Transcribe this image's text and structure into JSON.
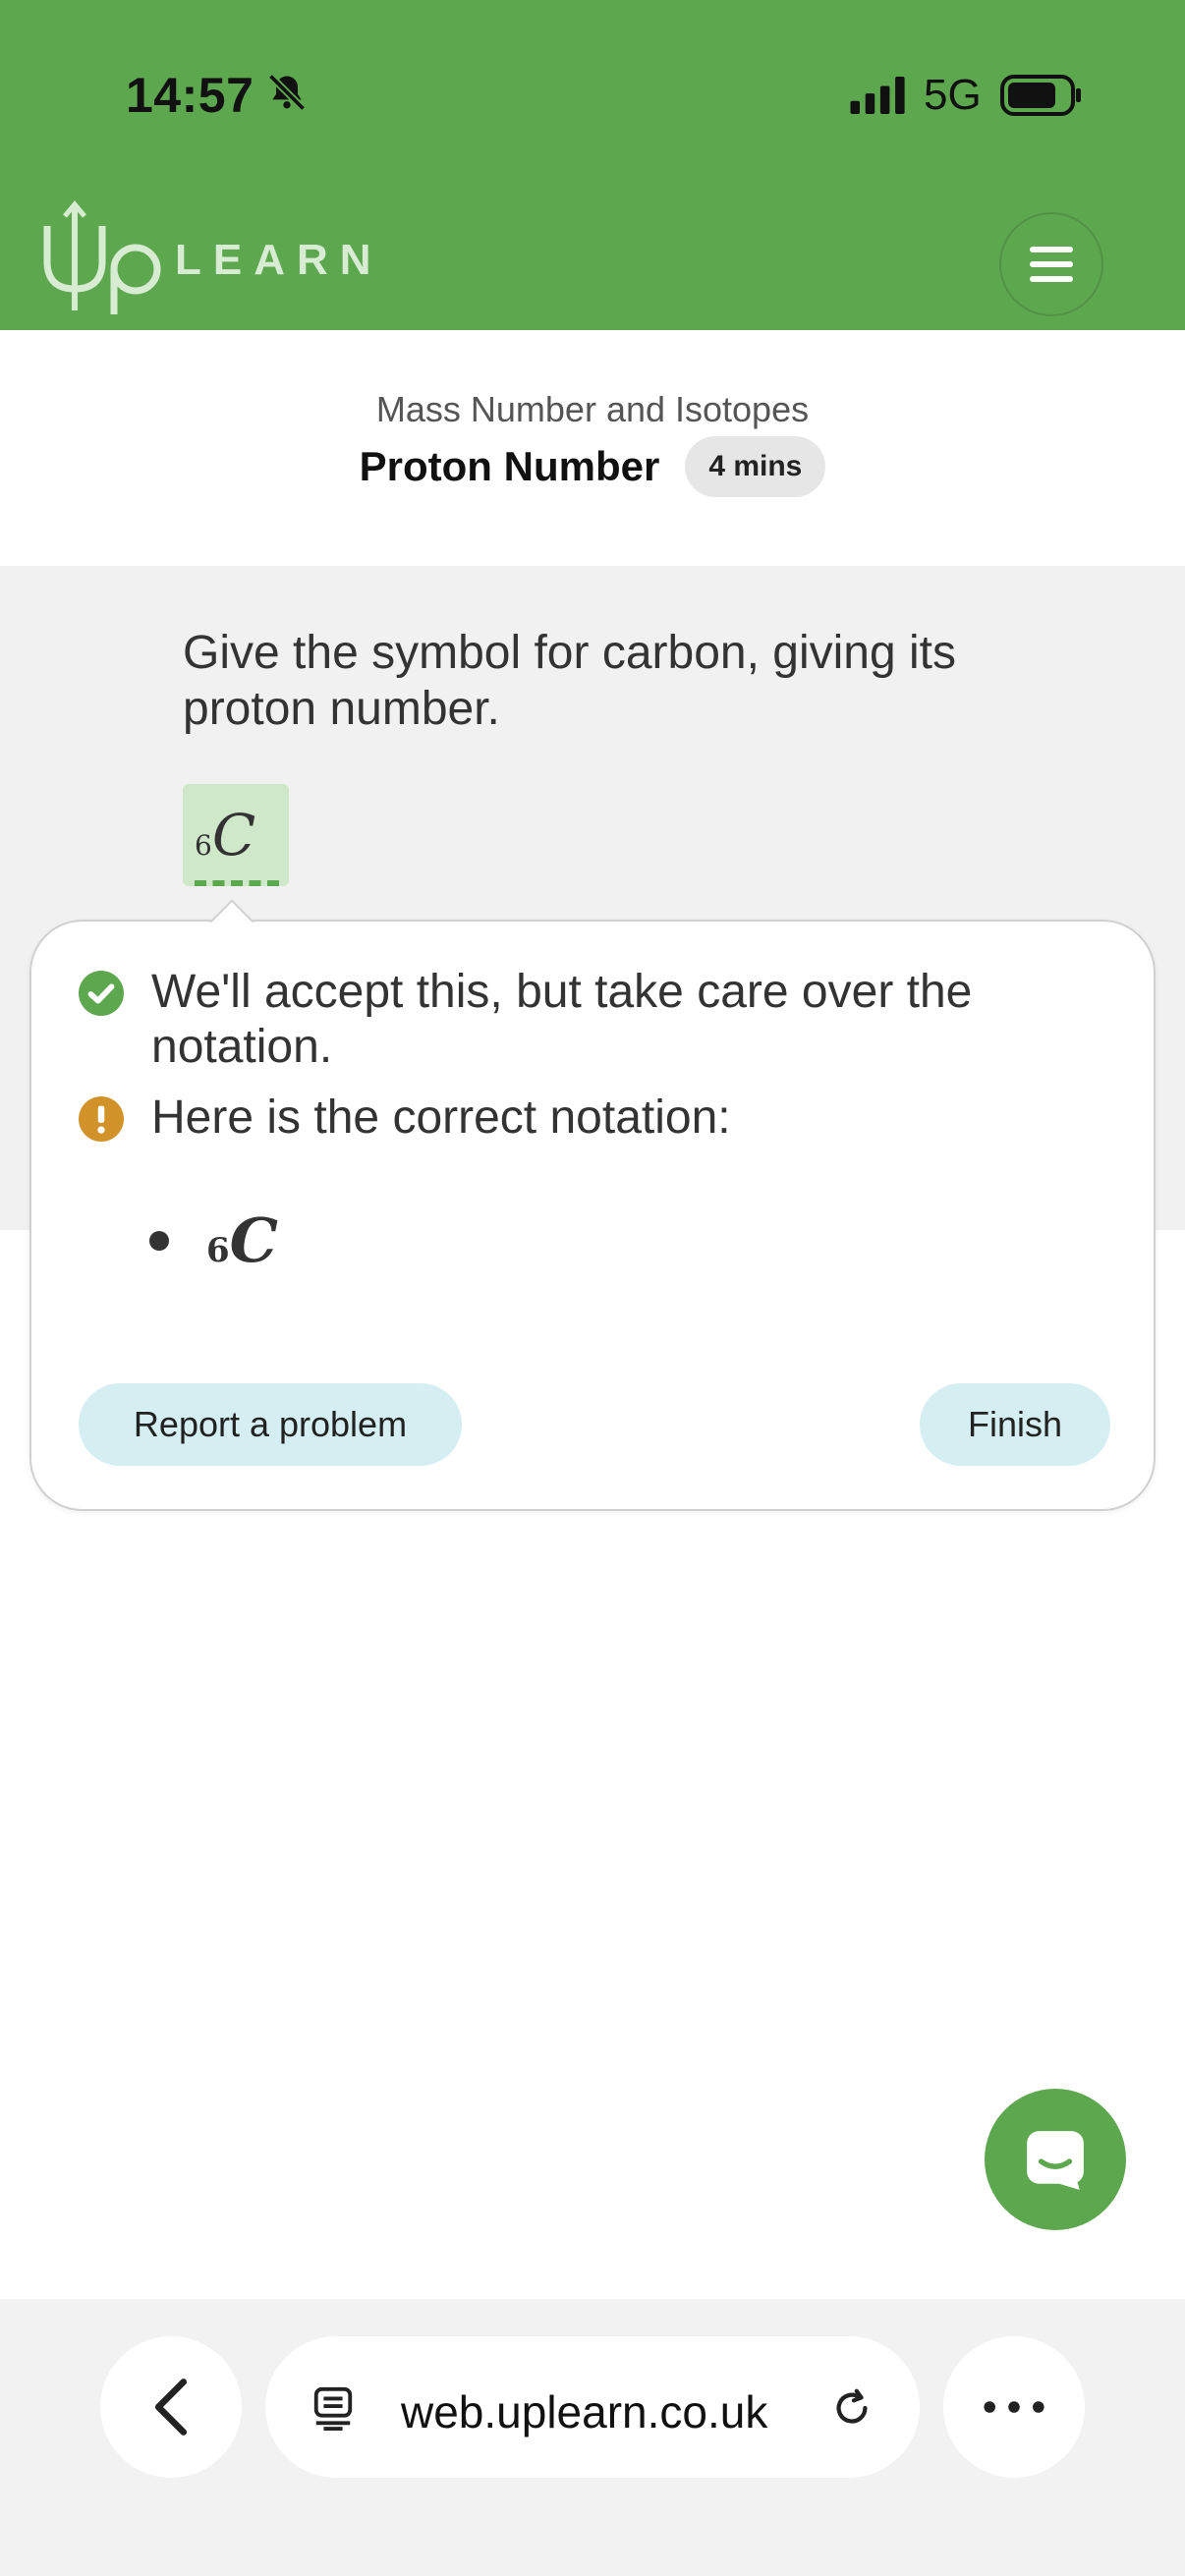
{
  "status_bar": {
    "time": "14:57",
    "network": "5G"
  },
  "header": {
    "logo_text": "LEARN"
  },
  "lesson": {
    "section": "Mass Number and Isotopes",
    "title": "Proton Number",
    "duration": "4 mins"
  },
  "question": {
    "text": "Give the symbol for carbon, giving its proton number.",
    "answer_subscript": "6",
    "answer_symbol": "C"
  },
  "feedback": {
    "accept_message": "We'll accept this, but take care over the notation.",
    "correction_message": "Here is the correct notation:",
    "correct_subscript": "6",
    "correct_symbol": "C",
    "report_label": "Report a problem",
    "finish_label": "Finish"
  },
  "browser": {
    "url": "web.uplearn.co.uk"
  },
  "colors": {
    "brand_green": "#5da74e",
    "warning_orange": "#d1922a",
    "pill_blue": "#d4eef2"
  },
  "icons": [
    "bell-off-icon",
    "signal-icon",
    "battery-icon",
    "menu-icon",
    "check-circle-icon",
    "alert-circle-icon",
    "chat-icon",
    "chevron-left-icon",
    "reader-icon",
    "reload-icon",
    "more-icon"
  ]
}
